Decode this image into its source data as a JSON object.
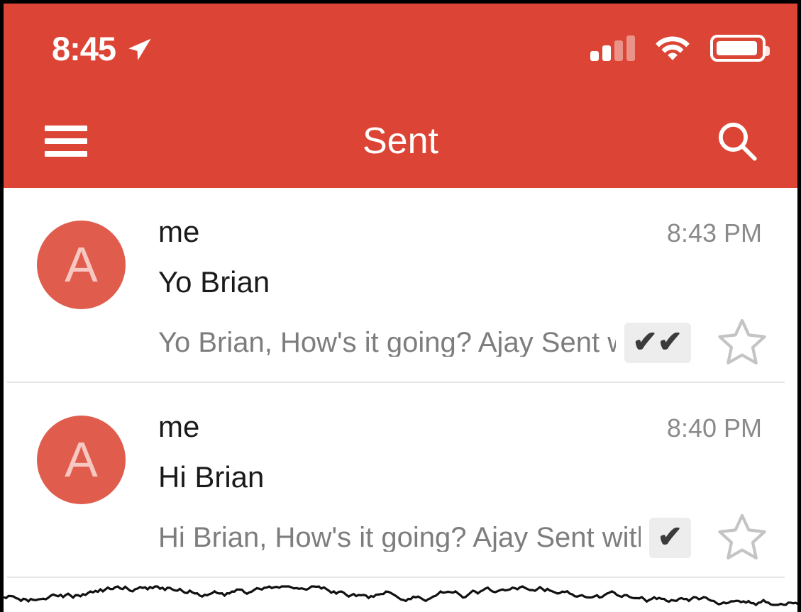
{
  "theme": {
    "accent": "#dc4435",
    "avatar_bg": "#e05d4e",
    "avatar_text": "#f7c8c2",
    "divider": "#e6e6e6",
    "snippet_text": "#7d7d7d",
    "tick_badge_bg": "#ededed",
    "star_outline": "#c4c4c4"
  },
  "status_bar": {
    "time": "8:45",
    "location_icon": "location-arrow-icon",
    "signal_icon": "cellular-signal-icon",
    "signal_bars_filled": 2,
    "signal_bars_total": 4,
    "wifi_icon": "wifi-icon",
    "battery_icon": "battery-icon",
    "battery_level_percent": 82
  },
  "nav_bar": {
    "menu_icon": "hamburger-menu-icon",
    "title": "Sent",
    "search_icon": "search-icon"
  },
  "list": {
    "items": [
      {
        "avatar_letter": "A",
        "sender": "me",
        "time": "8:43 PM",
        "subject": "Yo Brian",
        "snippet": "Yo Brian, How's it going? Ajay Sent wi...",
        "ticks": "✔✔",
        "tick_count": 2,
        "star_icon": "star-outline-icon",
        "starred": false
      },
      {
        "avatar_letter": "A",
        "sender": "me",
        "time": "8:40 PM",
        "subject": "Hi Brian",
        "snippet": "Hi Brian, How's it going? Ajay Sent with...",
        "ticks": "✔",
        "tick_count": 1,
        "star_icon": "star-outline-icon",
        "starred": false
      }
    ]
  }
}
